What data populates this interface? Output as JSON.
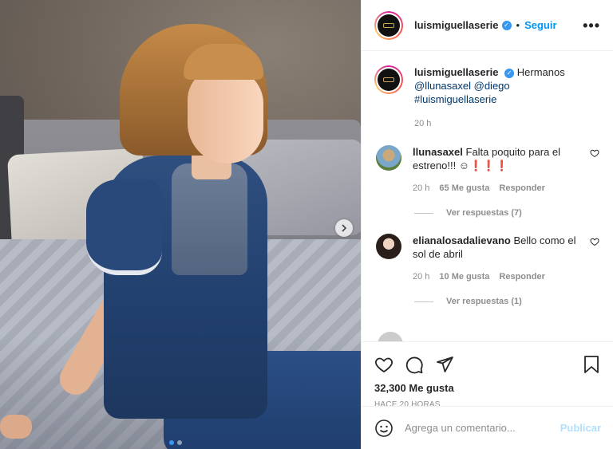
{
  "post": {
    "username": "luismiguellaserie",
    "separator": "•",
    "follow_label": "Seguir",
    "more_icon": "more-horizontal-icon",
    "caption": {
      "username": "luismiguellaserie",
      "text": "Hermanos",
      "mentions": "@llunasaxel @diego",
      "hashtag": "#luismiguellaserie",
      "time": "20 h"
    },
    "comments": [
      {
        "username": "llunasaxel",
        "text": "Falta poquito para el estreno!!! ☺❗❗❗",
        "time": "20 h",
        "likes": "65 Me gusta",
        "reply_label": "Responder",
        "view_replies": "Ver respuestas (7)"
      },
      {
        "username": "elianalosadalievano",
        "text": "Bello como el sol de abril",
        "time": "20 h",
        "likes": "10 Me gusta",
        "reply_label": "Responder",
        "view_replies": "Ver respuestas (1)"
      }
    ],
    "likes_count": "32,300 Me gusta",
    "time_ago": "HACE 20 HORAS"
  },
  "composer": {
    "placeholder": "Agrega un comentario...",
    "publish_label": "Publicar"
  },
  "carousel": {
    "total": 2,
    "active_index": 0
  },
  "colors": {
    "accent": "#0095f6",
    "verified": "#3897f0",
    "muted": "#8e8e8e",
    "publish_disabled": "#b2dffc"
  }
}
